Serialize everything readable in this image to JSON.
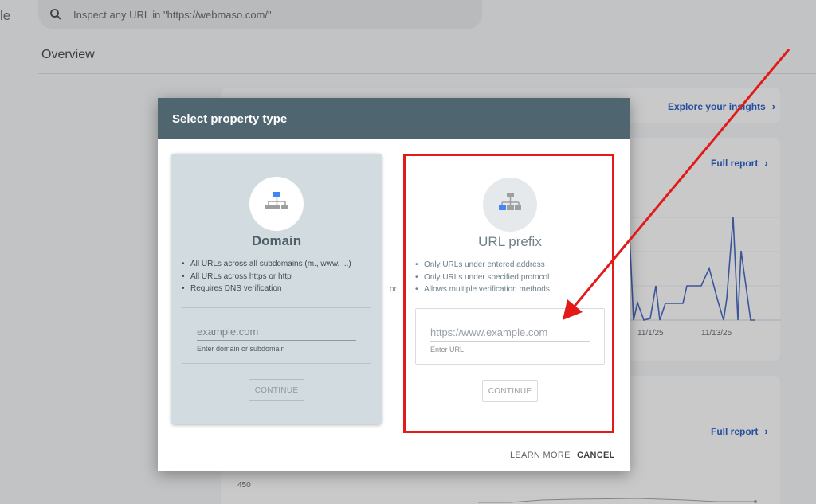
{
  "app": {
    "partial_brand": "le"
  },
  "search": {
    "placeholder": "Inspect any URL in \"https://webmaso.com/\""
  },
  "page": {
    "title": "Overview"
  },
  "insights": {
    "explore_label": "Explore your insights",
    "chevron": "›"
  },
  "reports": [
    {
      "label": "Full report",
      "chevron": "›"
    },
    {
      "label": "Full report",
      "chevron": "›"
    }
  ],
  "performance_chart": {
    "x_ticks": [
      "11/1/25",
      "11/13/25"
    ]
  },
  "lower_chart": {
    "y_tick": "450"
  },
  "dialog": {
    "title": "Select property type",
    "separator": "or",
    "domain": {
      "title": "Domain",
      "bullets": [
        "All URLs across all subdomains (m., www. ...)",
        "All URLs across https or http",
        "Requires DNS verification"
      ],
      "input_placeholder": "example.com",
      "input_hint": "Enter domain or subdomain",
      "continue_label": "CONTINUE",
      "icon": "sitemap-icon-top-highlight"
    },
    "url_prefix": {
      "title": "URL prefix",
      "bullets": [
        "Only URLs under entered address",
        "Only URLs under specified protocol",
        "Allows multiple verification methods"
      ],
      "input_placeholder": "https://www.example.com",
      "input_hint": "Enter URL",
      "continue_label": "CONTINUE",
      "icon": "sitemap-icon-left-highlight"
    },
    "footer": {
      "learn_more_label": "LEARN MORE",
      "cancel_label": "CANCEL"
    }
  },
  "colors": {
    "header_bg": "#4f6570",
    "domain_card_bg": "#d1dbe0",
    "link_blue": "#1a56c8",
    "annotation_red": "#e21a1a",
    "icon_blue": "#4285f4"
  }
}
